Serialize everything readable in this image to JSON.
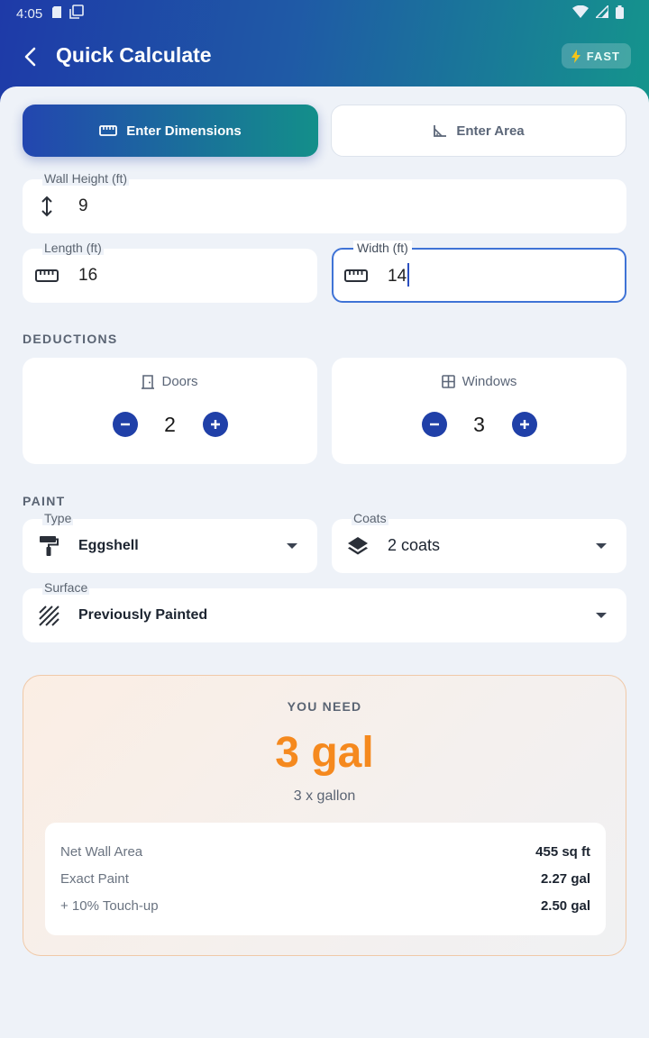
{
  "status_bar": {
    "time": "4:05"
  },
  "header": {
    "title": "Quick Calculate",
    "badge": "FAST"
  },
  "mode_tabs": [
    {
      "label": "Enter Dimensions",
      "active": true
    },
    {
      "label": "Enter Area",
      "active": false
    }
  ],
  "dimensions": {
    "wall_height": {
      "label": "Wall Height (ft)",
      "value": "9"
    },
    "length": {
      "label": "Length (ft)",
      "value": "16"
    },
    "width": {
      "label": "Width (ft)",
      "value": "14"
    }
  },
  "deductions": {
    "section_label": "DEDUCTIONS",
    "doors": {
      "label": "Doors",
      "count": "2"
    },
    "windows": {
      "label": "Windows",
      "count": "3"
    }
  },
  "paint": {
    "section_label": "PAINT",
    "type": {
      "label": "Type",
      "value": "Eggshell"
    },
    "coats": {
      "label": "Coats",
      "value": "2 coats"
    },
    "surface": {
      "label": "Surface",
      "value": "Previously Painted"
    }
  },
  "result": {
    "heading": "YOU NEED",
    "amount": "3 gal",
    "breakdown": "3 x gallon",
    "details": [
      {
        "label": "Net Wall Area",
        "value": "455 sq ft"
      },
      {
        "label": "Exact Paint",
        "value": "2.27 gal"
      },
      {
        "label": "+ 10% Touch-up",
        "value": "2.50 gal"
      }
    ]
  },
  "colors": {
    "accent": "#2040a8",
    "result_accent": "#f5891e",
    "teal": "#138f8a"
  }
}
